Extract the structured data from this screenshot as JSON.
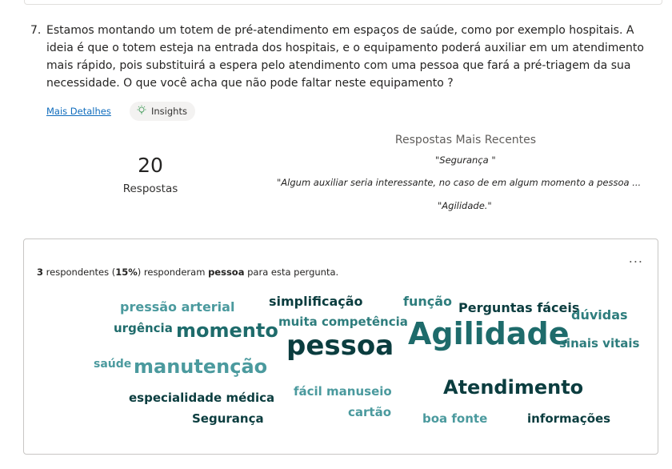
{
  "question": {
    "number": "7.",
    "text": "Estamos montando um totem de pré-atendimento em espaços de saúde, como por exemplo hospitais. A ideia é que o totem esteja na entrada dos hospitais, e o equipamento poderá auxiliar em um atendimento mais rápido, pois substituirá a espera pelo atendimento com uma pessoa que fará a pré-triagem da sua necessidade.  O que você acha que não pode faltar neste equipamento ?",
    "details_link": "Mais Detalhes",
    "insights_label": "Insights",
    "insights_icon": "lightbulb-icon"
  },
  "summary": {
    "count": "20",
    "count_label": "Respostas"
  },
  "recent": {
    "title": "Respostas Mais Recentes",
    "items": [
      "\"Segurança \"",
      "\"Algum auxiliar seria interessante, no caso de em algum momento a pessoa ...",
      "\"Agilidade.\""
    ]
  },
  "cloud_card": {
    "more_label": "...",
    "respondents_count": "3",
    "respondents_text_1": " respondentes (",
    "respondents_percent": "15%",
    "respondents_text_2": ") responderam ",
    "selected_word": "pessoa",
    "respondents_text_3": " para esta pergunta."
  },
  "word_cloud": [
    {
      "text": "pressão arterial",
      "color": "#4b9a9e"
    },
    {
      "text": "simplificação",
      "color": "#0b3d3f"
    },
    {
      "text": "função",
      "color": "#2e7d7d"
    },
    {
      "text": "Perguntas fáceis",
      "color": "#0b3d3f"
    },
    {
      "text": "dúvidas",
      "color": "#2e7d7d"
    },
    {
      "text": "urgência",
      "color": "#1e6b6b"
    },
    {
      "text": "momento",
      "color": "#1e6b6b"
    },
    {
      "text": "muita competência",
      "color": "#2e7d7d"
    },
    {
      "text": "Agilidade",
      "color": "#1e6b6b"
    },
    {
      "text": "sinais vitais",
      "color": "#2e7d7d"
    },
    {
      "text": "pessoa",
      "color": "#0b3d3f"
    },
    {
      "text": "saúde",
      "color": "#4b9a9e"
    },
    {
      "text": "manutenção",
      "color": "#4b9a9e"
    },
    {
      "text": "fácil manuseio",
      "color": "#4b9a9e"
    },
    {
      "text": "Atendimento",
      "color": "#0b3d3f"
    },
    {
      "text": "especialidade médica",
      "color": "#0b3d3f"
    },
    {
      "text": "cartão",
      "color": "#4b9a9e"
    },
    {
      "text": "Segurança",
      "color": "#0b3d3f"
    },
    {
      "text": "boa fonte",
      "color": "#4b9a9e"
    },
    {
      "text": "informações",
      "color": "#0b3d3f"
    }
  ]
}
